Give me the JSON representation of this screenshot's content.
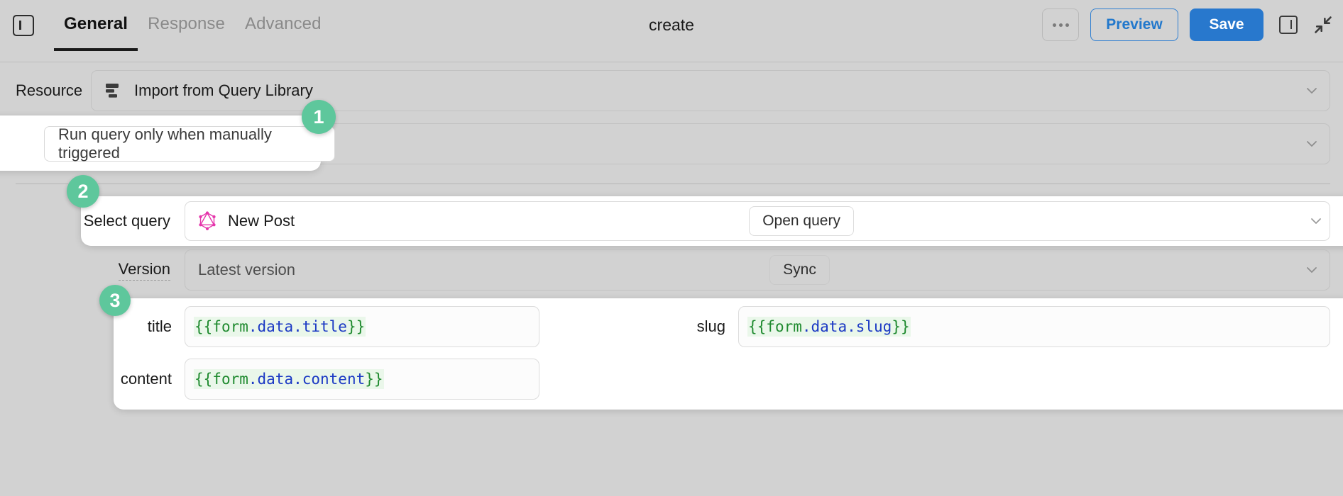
{
  "header": {
    "panel_toggle_icon": "left-panel-icon",
    "tabs": [
      {
        "label": "General",
        "active": true
      },
      {
        "label": "Response",
        "active": false
      },
      {
        "label": "Advanced",
        "active": false
      }
    ],
    "title": "create",
    "more_button_label": "···",
    "preview_label": "Preview",
    "save_label": "Save",
    "right_panel_icon": "right-panel-icon",
    "collapse_icon": "collapse-arrows-icon"
  },
  "resource": {
    "label": "Resource",
    "icon": "database-icon",
    "value": "Import from Query Library"
  },
  "trigger": {
    "value": "Run query only when manually triggered"
  },
  "select_query": {
    "label": "Select query",
    "icon": "graphql-icon",
    "value": "New Post",
    "open_query_label": "Open query"
  },
  "version": {
    "label": "Version",
    "value": "Latest version",
    "sync_label": "Sync"
  },
  "form_fields": [
    {
      "label": "title",
      "braces_open": "{{",
      "root": "form",
      "path": ".data.title",
      "braces_close": "}}"
    },
    {
      "label": "slug",
      "braces_open": "{{",
      "root": "form",
      "path": ".data.slug",
      "braces_close": "}}"
    },
    {
      "label": "content",
      "braces_open": "{{",
      "root": "form",
      "path": ".data.content",
      "braces_close": "}}"
    }
  ],
  "badges": [
    {
      "number": "1"
    },
    {
      "number": "2"
    },
    {
      "number": "3"
    }
  ],
  "colors": {
    "accent_blue": "#2878cd",
    "badge_green": "#5ec79c",
    "graphql_pink": "#e535ab",
    "code_green": "#1f8a2f",
    "code_blue": "#1b39c4",
    "code_bg": "#eaf7ea",
    "page_bg": "#d2d2d2"
  }
}
